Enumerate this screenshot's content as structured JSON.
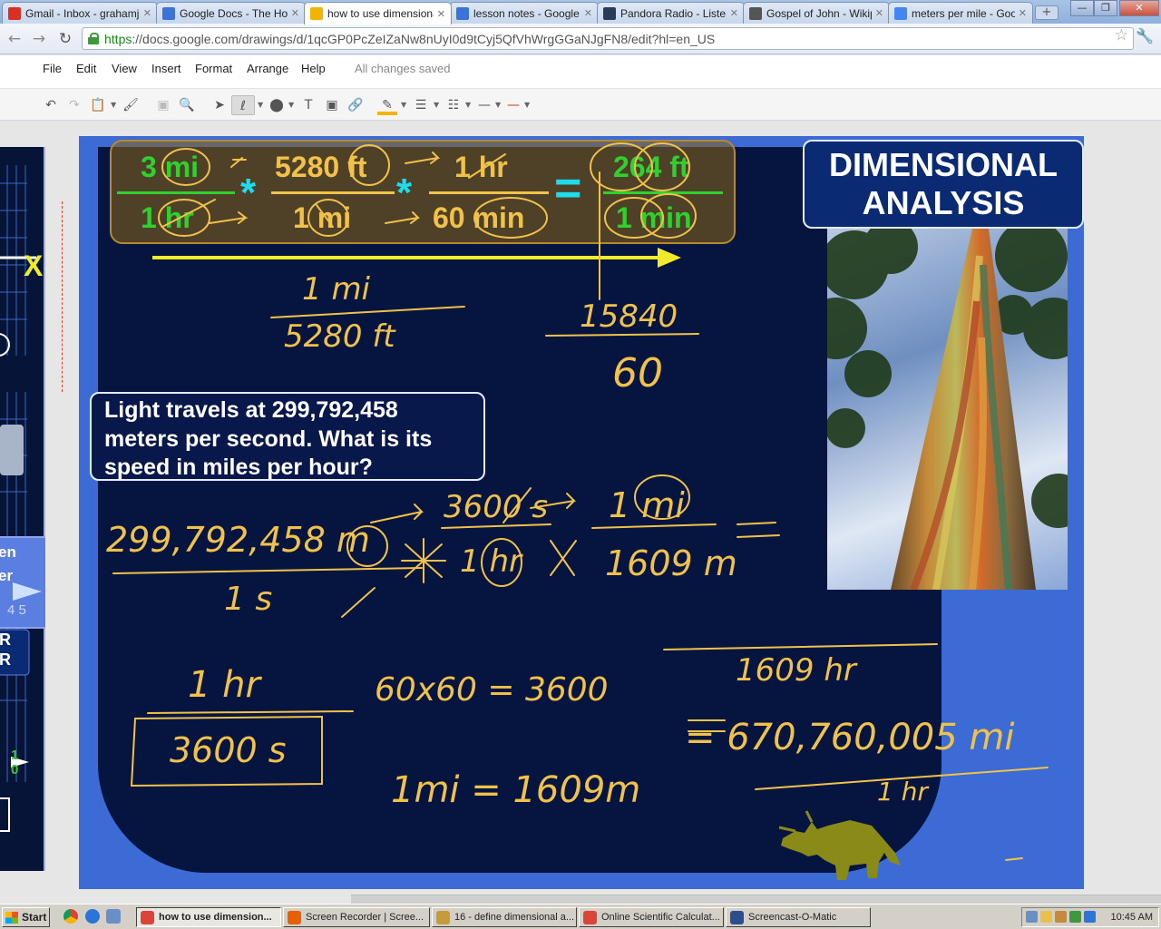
{
  "browser": {
    "tabs": [
      {
        "label": "Gmail - Inbox - grahamj",
        "icon": "gmail-icon",
        "color": "#d93025"
      },
      {
        "label": "Google Docs - The Hopp",
        "icon": "google-docs-icon",
        "color": "#3b73d8"
      },
      {
        "label": "how to use dimensional",
        "icon": "google-drawings-icon",
        "color": "#f2b400",
        "active": true
      },
      {
        "label": "lesson notes - Google D",
        "icon": "google-docs-icon",
        "color": "#3b73d8"
      },
      {
        "label": "Pandora Radio - Listen t",
        "icon": "pandora-icon",
        "color": "#2b3a59"
      },
      {
        "label": "Gospel of John - Wikipe",
        "icon": "wikipedia-icon",
        "color": "#555555"
      },
      {
        "label": "meters per mile - Google",
        "icon": "google-icon",
        "color": "#4285f4"
      }
    ],
    "url_scheme": "https",
    "url_rest": "://docs.google.com/drawings/d/1qcGP0PcZeIZaNw8nUyI0d9tCyj5QfVhWrgGGaNJgFN8/edit?hl=en_US"
  },
  "docs": {
    "menus": [
      "File",
      "Edit",
      "View",
      "Insert",
      "Format",
      "Arrange",
      "Help"
    ],
    "save_status": "All changes saved"
  },
  "slide": {
    "title_line1": "DIMENSIONAL",
    "title_line2": "ANALYSIS",
    "equation": {
      "f1_num": "3 mi",
      "f1_den": "1 hr",
      "f2_num": "5280 ft",
      "f2_den": "1 mi",
      "f3_num": "1 hr",
      "f3_den": "60 min",
      "result_num": "264 ft",
      "result_den": "1 min",
      "times": "*",
      "equals": "="
    },
    "question": "Light travels at 299,792,458 meters per second. What is its speed in miles per hour?",
    "handwriting": {
      "note1_num": "1 mi",
      "note1_den": "5280 ft",
      "note2_num": "15840",
      "note2_den": "60",
      "speed_num": "299,792,458 m",
      "speed_den": "1 s",
      "conv1_num": "3600 s",
      "conv1_den": "1 hr",
      "conv2_num": "1 mi",
      "conv2_den": "1609 m",
      "hour_num": "1 hr",
      "hour_den": "3600 s",
      "calc": "60x60 = 3600",
      "miles_eq": "1mi = 1609m",
      "big_top": "1609 hr",
      "big_result": "= 670,760,005 mi",
      "big_den": "1 hr"
    },
    "left_slide_fragments": [
      "en",
      "er",
      "4 5",
      "R",
      "R",
      "1",
      "0"
    ]
  },
  "taskbar": {
    "start": "Start",
    "tasks": [
      {
        "label": "how to use dimension...",
        "icon": "chrome-icon",
        "color": "#db4437",
        "active": true
      },
      {
        "label": "Screen Recorder | Scree...",
        "icon": "firefox-icon",
        "color": "#e66000"
      },
      {
        "label": "16 - define dimensional a...",
        "icon": "paint-icon",
        "color": "#c59b3b"
      },
      {
        "label": "Online Scientific Calculat...",
        "icon": "chrome-icon",
        "color": "#db4437"
      },
      {
        "label": "Screencast-O-Matic",
        "icon": "screencast-icon",
        "color": "#2b4f8a"
      }
    ],
    "clock": "10:45 AM"
  },
  "colors": {
    "ink": "#f0c24a",
    "slide_bg": "#3c6bd6",
    "panel": "#061440",
    "arrow": "#f0ec2a",
    "eq_green": "#2fd12f"
  }
}
